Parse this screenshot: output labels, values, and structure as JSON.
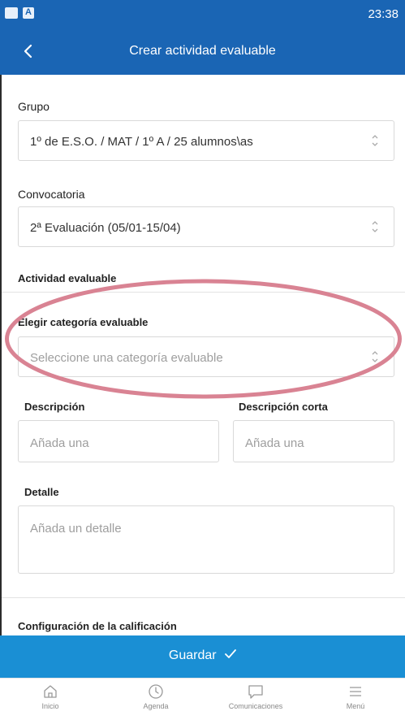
{
  "status_bar": {
    "time": "23:38"
  },
  "app_bar": {
    "title": "Crear actividad evaluable"
  },
  "form": {
    "grupo": {
      "label": "Grupo",
      "value": "1º de E.S.O. / MAT / 1º A / 25 alumnos\\as"
    },
    "convocatoria": {
      "label": "Convocatoria",
      "value": "2ª Evaluación (05/01-15/04)"
    },
    "section_actividad": "Actividad evaluable",
    "categoria": {
      "label": "Elegir categoría evaluable",
      "placeholder": "Seleccione una categoría evaluable"
    },
    "descripcion": {
      "label": "Descripción",
      "placeholder": "Añada una"
    },
    "descripcion_corta": {
      "label": "Descripción corta",
      "placeholder": "Añada una"
    },
    "detalle": {
      "label": "Detalle",
      "placeholder": "Añada un detalle"
    },
    "section_calificacion": "Configuración de la calificación"
  },
  "save_button": {
    "label": "Guardar",
    "icon": "check-icon"
  },
  "bottom_nav": [
    {
      "label": "Inicio",
      "icon": "home-icon"
    },
    {
      "label": "Agenda",
      "icon": "clock-icon"
    },
    {
      "label": "Comunicaciones",
      "icon": "message-icon"
    },
    {
      "label": "Menú",
      "icon": "menu-icon"
    }
  ],
  "colors": {
    "primary": "#1a65b4",
    "save": "#1a8fd4",
    "highlight": "#d98393"
  }
}
